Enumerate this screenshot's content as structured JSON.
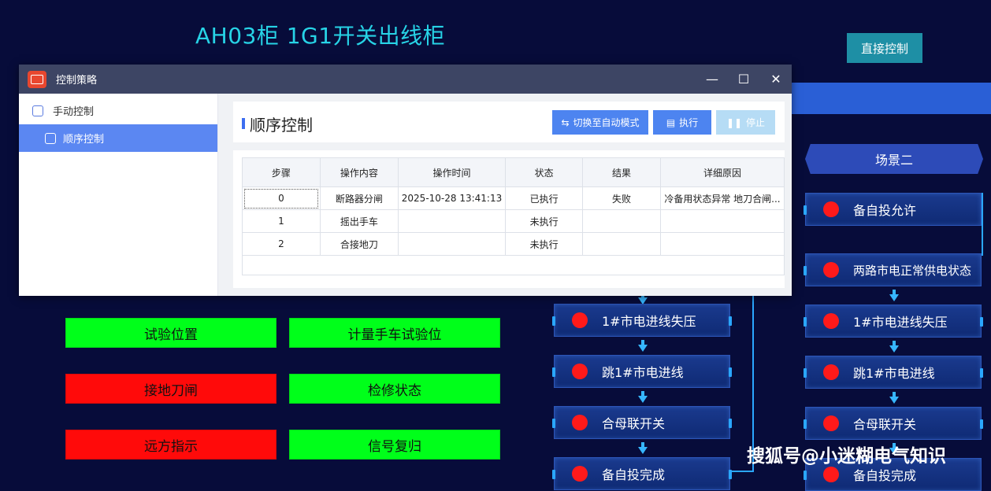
{
  "page_title": "AH03柜 1G1开关出线柜",
  "direct_control": "直接控制",
  "buttons": {
    "test_position": "试验位置",
    "meter_handcart_test": "计量手车试验位",
    "earth_switch": "接地刀闸",
    "maintenance": "检修状态",
    "remote": "远方指示",
    "signal_reset": "信号复归"
  },
  "colors": {
    "green": "#00ff1a",
    "red": "#ff0a0a",
    "accent": "#27d3e6"
  },
  "flow_left": [
    "1#市电进线失压",
    "跳1#市电进线",
    "合母联开关",
    "备自投完成"
  ],
  "scene2": {
    "title": "场景二",
    "nodes": [
      "备自投允许",
      "两路市电正常供电状态",
      "1#市电进线失压",
      "跳1#市电进线",
      "合母联开关",
      "备自投完成"
    ]
  },
  "watermark": "搜狐号@小迷糊电气知识",
  "dialog": {
    "title": "控制策略",
    "sidebar": {
      "manual": "手动控制",
      "sequence": "顺序控制"
    },
    "panel_title": "顺序控制",
    "toolbar": {
      "switch_auto": "切换至自动模式",
      "execute": "执行",
      "stop": "停止"
    },
    "table": {
      "headers": [
        "步骤",
        "操作内容",
        "操作时间",
        "状态",
        "结果",
        "详细原因"
      ],
      "rows": [
        [
          "0",
          "断路器分闸",
          "2025-10-28 13:41:13",
          "已执行",
          "失败",
          "冷备用状态异常 地刀合闸..."
        ],
        [
          "1",
          "摇出手车",
          "",
          "未执行",
          "",
          ""
        ],
        [
          "2",
          "合接地刀",
          "",
          "未执行",
          "",
          ""
        ]
      ]
    }
  }
}
